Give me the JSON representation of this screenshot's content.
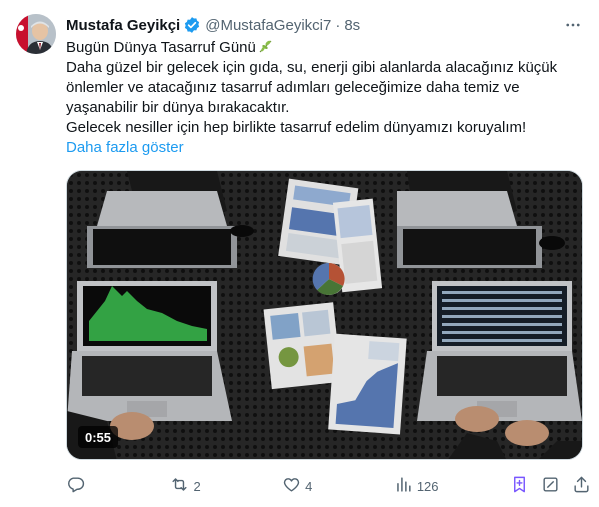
{
  "author": {
    "name": "Mustafa Geyikçi",
    "handle": "@MustafaGeyikci7",
    "dot": "·",
    "time": "8s",
    "verified_color": "#1d9bf0"
  },
  "tweet": {
    "lines": [
      "Bugün Dünya Tasarruf Günü",
      "Daha güzel bir gelecek için gıda, su, enerji gibi alanlarda alacağınız küçük",
      "önlemler ve atacağınız tasarruf adımları geleceğimize daha temiz ve",
      "yaşanabilir bir dünya bırakacaktır.",
      "Gelecek nesiller için hep birlikte tasarruf edelim dünyamızı koruyalım!"
    ],
    "first_line_emoji": "leaf-icon",
    "show_more": "Daha fazla göster"
  },
  "media": {
    "duration": "0:55"
  },
  "actions": {
    "replies": "",
    "retweets": "2",
    "likes": "4",
    "views": "126"
  },
  "colors": {
    "text": "#0f1419",
    "secondary": "#536471",
    "link": "#1d9bf0",
    "bookmark_accent": "#7856ff"
  }
}
